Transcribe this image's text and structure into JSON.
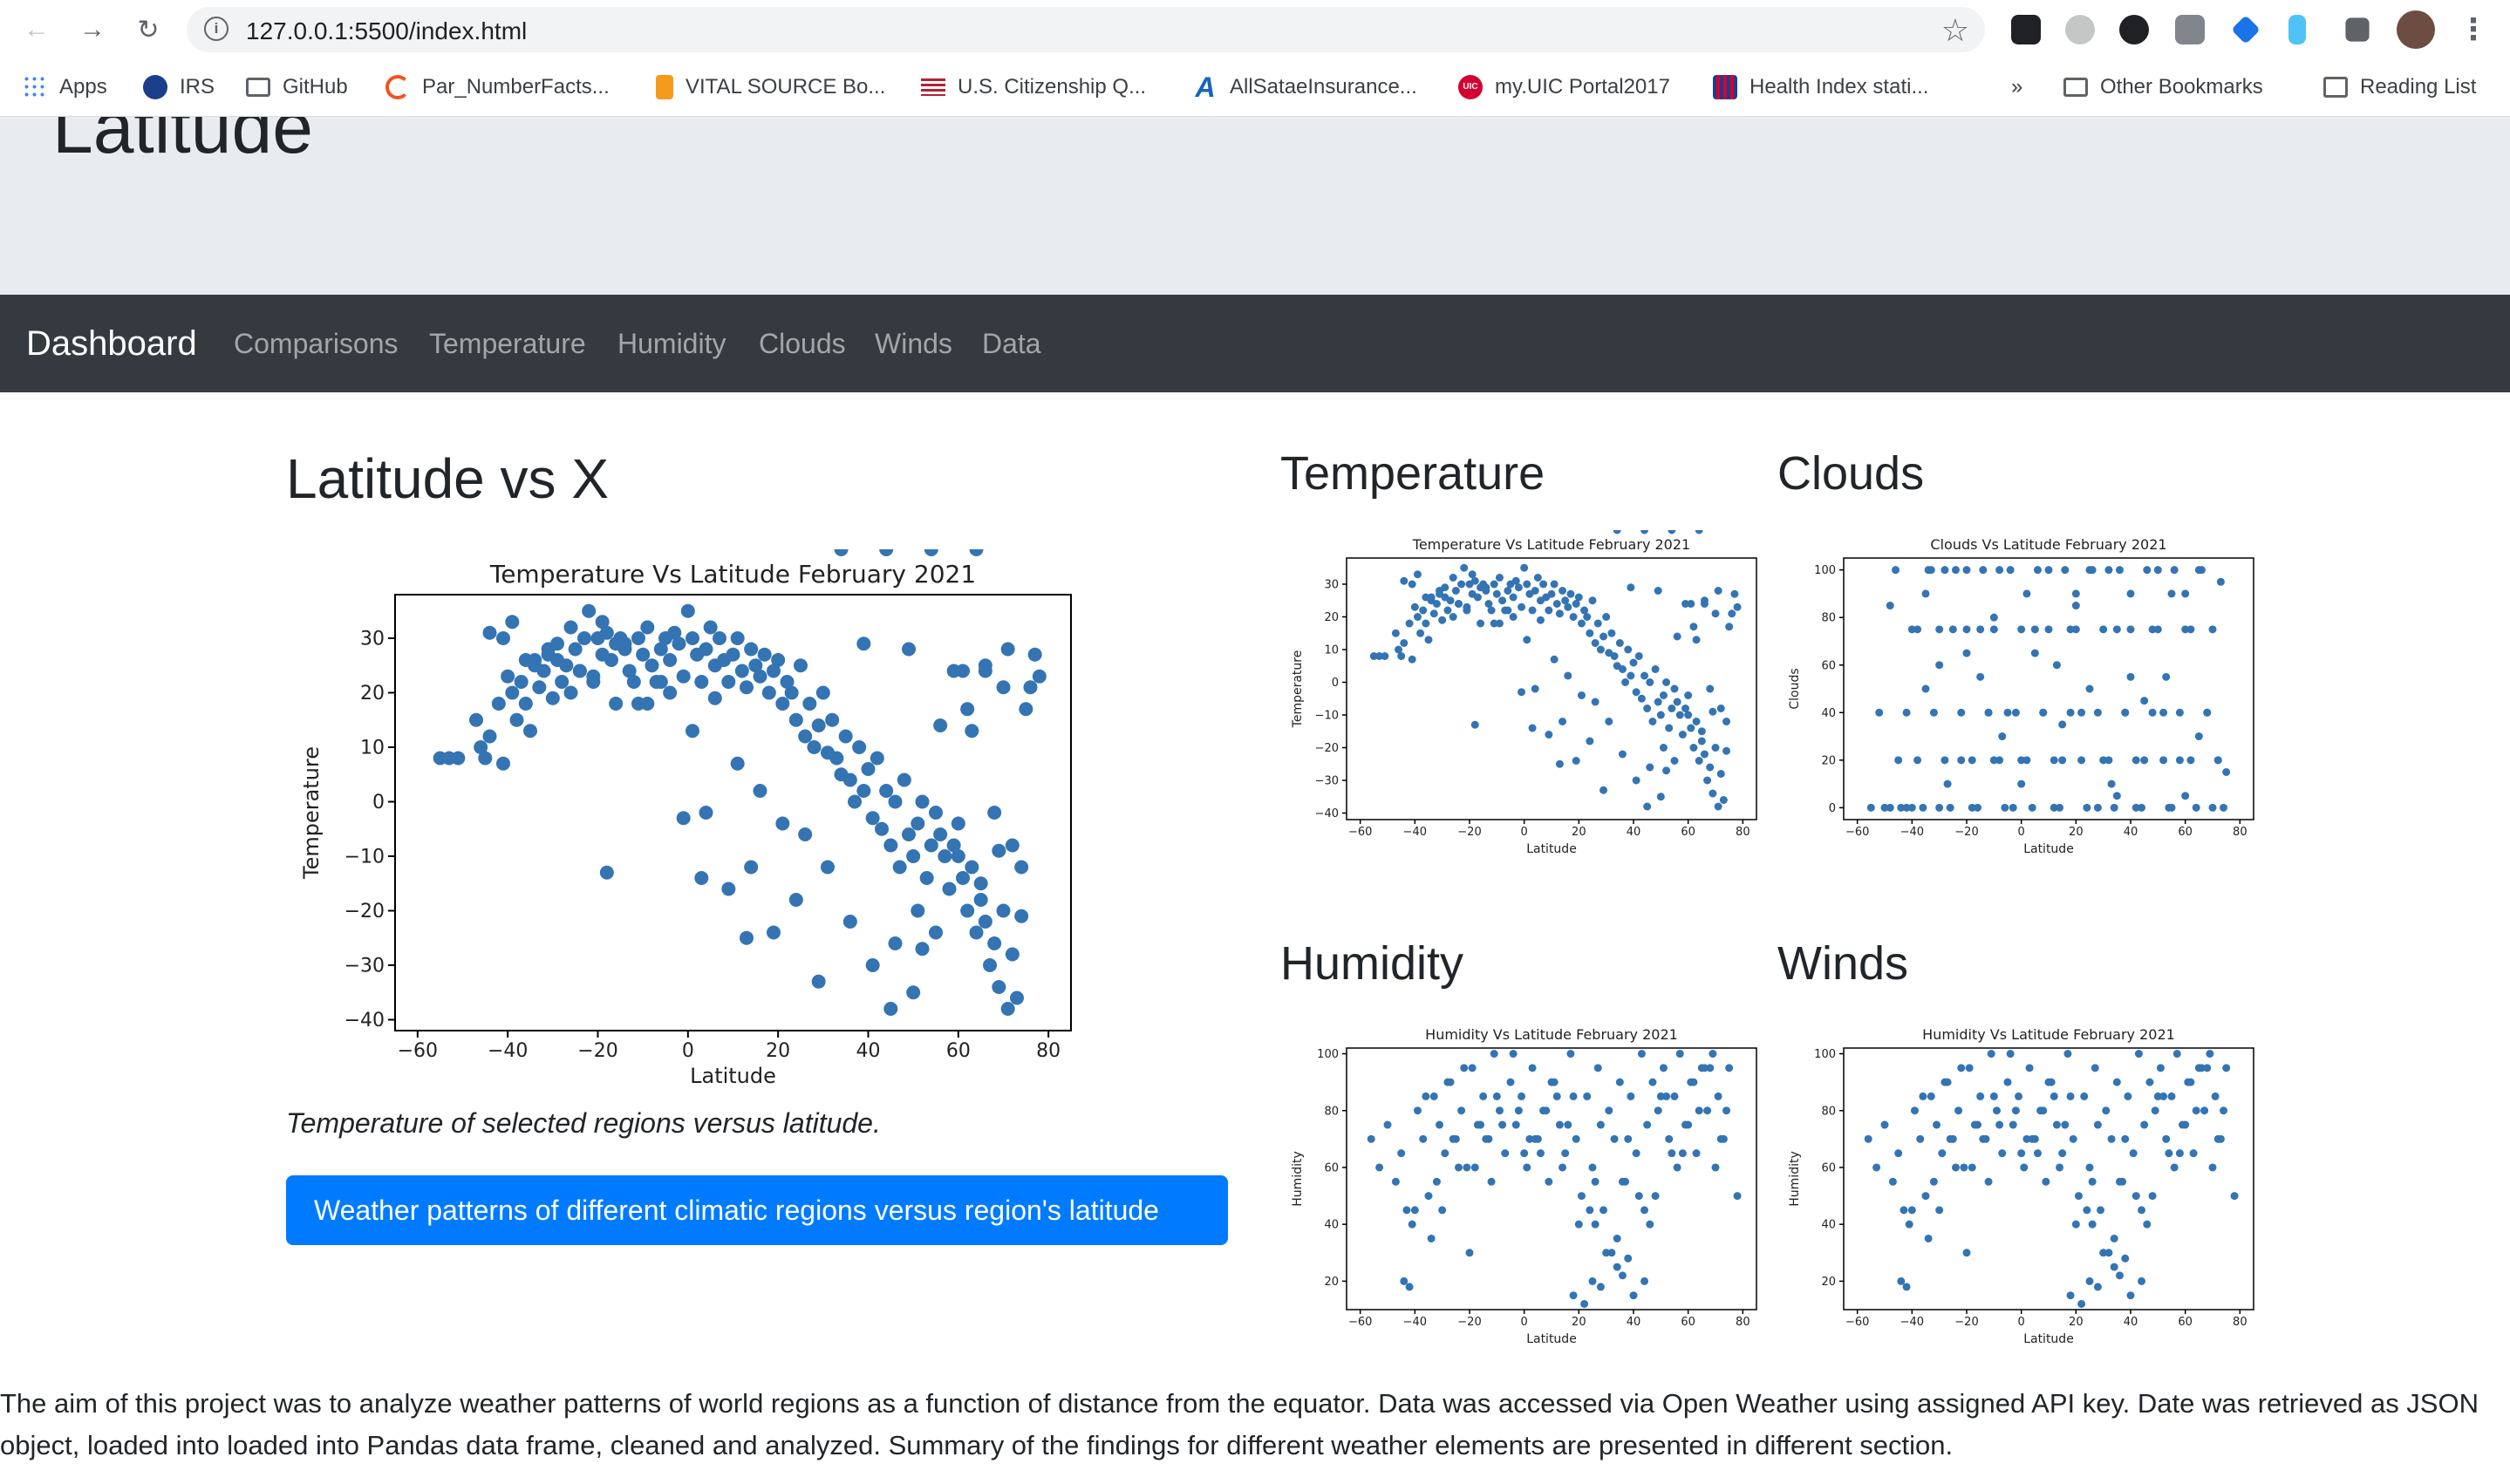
{
  "browser": {
    "url": "127.0.0.1:5500/index.html",
    "bookmarks": [
      {
        "label": "Apps",
        "icon": "apps-grid-icon",
        "color": "#4285f4"
      },
      {
        "label": "IRS",
        "icon": "irs-logo-icon",
        "color": "#1b3f8b"
      },
      {
        "label": "GitHub",
        "icon": "folder-icon",
        "color": "#5f6368"
      },
      {
        "label": "Par_NumberFacts...",
        "icon": "loading-ring-icon",
        "color": "#f4511e"
      },
      {
        "label": "VITAL SOURCE Bo...",
        "icon": "vitalsource-icon",
        "color": "#f59b1c"
      },
      {
        "label": "U.S. Citizenship Q...",
        "icon": "us-flag-icon",
        "color": "#b22234"
      },
      {
        "label": "AllSataeInsurance...",
        "icon": "allstate-icon",
        "color": "#1565c0"
      },
      {
        "label": "my.UIC Portal2017",
        "icon": "uic-logo-icon",
        "color": "#d50032"
      },
      {
        "label": "Health Index stati...",
        "icon": "health-index-icon",
        "color": "#1b3f8b"
      }
    ],
    "overflow": "»",
    "other_bookmarks": "Other Bookmarks",
    "reading_list": "Reading List"
  },
  "page": {
    "header": "Latitude",
    "nav": {
      "brand": "Dashboard",
      "links": [
        "Comparisons",
        "Temperature",
        "Humidity",
        "Clouds",
        "Winds",
        "Data"
      ]
    },
    "main": {
      "title": "Latitude vs X",
      "caption": "Temperature of selected regions versus latitude.",
      "button": "Weather patterns of different climatic regions versus region's latitude"
    },
    "thumbs": {
      "temperature": "Temperature",
      "clouds": "Clouds",
      "humidity": "Humidity",
      "winds": "Winds"
    },
    "summary": "The aim of this project was to analyze weather patterns of world regions as a function of distance from the equator. Data was accessed via Open Weather using assigned API key. Date was retrieved as JSON object, loaded into loaded into Pandas data frame, cleaned and analyzed. Summary of the findings for different weather elements are presented in different section."
  },
  "colors": {
    "marker": "#3474b3",
    "navbar": "#343a40",
    "jumbotron": "#e9ecef",
    "button": "#007bff"
  },
  "chart_data": [
    {
      "id": "main-temperature",
      "type": "scatter",
      "title": "Temperature Vs Latitude February 2021",
      "xlabel": "Latitude",
      "ylabel": "Temperature",
      "xlim": [
        -65,
        85
      ],
      "ylim": [
        -42,
        38
      ],
      "xticks": [
        -60,
        -40,
        -20,
        0,
        20,
        40,
        60,
        80
      ],
      "yticks": [
        -40,
        -30,
        -20,
        -10,
        0,
        10,
        20,
        30
      ],
      "x": [
        -55,
        -53,
        -51,
        -47,
        -46,
        -45,
        -44,
        -42,
        -41,
        -40,
        -39,
        -38,
        -37,
        -36,
        -35,
        -34,
        -33,
        -32,
        -31,
        -30,
        -29,
        -28,
        -27,
        -26,
        -25,
        -24,
        -23,
        -22,
        -21,
        -20,
        -19,
        -18,
        -17,
        -16,
        -15,
        -14,
        -13,
        -12,
        -11,
        -10,
        -9,
        -8,
        -7,
        -6,
        -5,
        -4,
        -3,
        -2,
        -1,
        0,
        1,
        2,
        3,
        4,
        5,
        6,
        7,
        8,
        9,
        10,
        11,
        12,
        13,
        14,
        15,
        16,
        17,
        18,
        19,
        20,
        21,
        22,
        23,
        24,
        25,
        26,
        27,
        28,
        29,
        30,
        31,
        32,
        33,
        34,
        35,
        36,
        37,
        38,
        39,
        40,
        41,
        42,
        43,
        44,
        45,
        46,
        47,
        48,
        49,
        50,
        51,
        52,
        53,
        54,
        55,
        56,
        57,
        58,
        59,
        60,
        61,
        62,
        63,
        64,
        65,
        66,
        67,
        68,
        69,
        70,
        71,
        72,
        73,
        74,
        75,
        76,
        77,
        78,
        -44,
        -39,
        -34,
        -29,
        -24,
        -19,
        -14,
        -9,
        -4,
        1,
        6,
        11,
        16,
        21,
        26,
        31,
        36,
        41,
        46,
        51,
        56,
        61,
        66,
        71,
        -41,
        -31,
        -21,
        -11,
        -1,
        9,
        19,
        29,
        39,
        49,
        59,
        69,
        -18,
        3,
        13,
        50,
        55,
        65,
        68,
        72,
        74,
        45,
        52,
        60,
        63,
        70,
        62,
        66,
        -36,
        -26,
        -16,
        -6,
        4,
        14,
        24,
        34,
        44,
        54,
        64
      ],
      "y": [
        8,
        8,
        8,
        15,
        10,
        8,
        12,
        18,
        7,
        23,
        20,
        15,
        22,
        18,
        13,
        25,
        21,
        24,
        27,
        19,
        26,
        22,
        25,
        20,
        28,
        24,
        30,
        35,
        22,
        30,
        27,
        31,
        26,
        18,
        30,
        28,
        24,
        22,
        30,
        27,
        32,
        25,
        22,
        28,
        30,
        26,
        31,
        29,
        23,
        35,
        30,
        27,
        22,
        28,
        32,
        25,
        30,
        26,
        22,
        27,
        30,
        24,
        21,
        28,
        25,
        23,
        27,
        20,
        24,
        26,
        18,
        22,
        20,
        15,
        25,
        12,
        18,
        10,
        14,
        20,
        9,
        15,
        8,
        5,
        12,
        4,
        0,
        10,
        2,
        6,
        -3,
        8,
        -5,
        2,
        -8,
        0,
        -12,
        4,
        -6,
        -10,
        -4,
        0,
        -14,
        -8,
        -2,
        -6,
        -10,
        -16,
        -8,
        -4,
        -14,
        -20,
        -12,
        -24,
        -18,
        -22,
        -30,
        -26,
        -34,
        -20,
        -38,
        -28,
        -36,
        -21,
        17,
        21,
        27,
        23,
        31,
        33,
        26,
        29,
        24,
        33,
        29,
        18,
        20,
        13,
        19,
        7,
        2,
        -4,
        -6,
        -12,
        -22,
        -30,
        -26,
        -20,
        14,
        24,
        25,
        28,
        30,
        28,
        23,
        18,
        -3,
        -16,
        -24,
        -33,
        29,
        28,
        24,
        -9,
        -13,
        -14,
        -25,
        -35,
        -24,
        -15,
        -2,
        -8,
        -12,
        -38,
        -27,
        -10,
        13,
        21,
        17,
        24,
        26,
        32,
        29,
        22,
        -2,
        -12,
        -18
      ]
    },
    {
      "id": "thumb-temperature",
      "type": "scatter",
      "title": "Temperature Vs Latitude February 2021",
      "xlabel": "Latitude",
      "ylabel": "Temperature",
      "xlim": [
        -65,
        85
      ],
      "ylim": [
        -42,
        38
      ],
      "xticks": [
        -60,
        -40,
        -20,
        0,
        20,
        40,
        60,
        80
      ],
      "yticks": [
        -40,
        -30,
        -20,
        -10,
        0,
        10,
        20,
        30
      ],
      "same_as": "main-temperature"
    },
    {
      "id": "thumb-clouds",
      "type": "scatter",
      "title": "Clouds Vs Latitude February 2021",
      "xlabel": "Latitude",
      "ylabel": "Clouds",
      "xlim": [
        -65,
        85
      ],
      "ylim": [
        -5,
        105
      ],
      "xticks": [
        -60,
        -40,
        -20,
        0,
        20,
        40,
        60,
        80
      ],
      "yticks": [
        0,
        20,
        40,
        60,
        80,
        100
      ],
      "x": [
        -55,
        -52,
        -48,
        -45,
        -42,
        -40,
        -38,
        -35,
        -33,
        -30,
        -28,
        -25,
        -22,
        -20,
        -18,
        -15,
        -12,
        -10,
        -8,
        -5,
        -3,
        0,
        2,
        5,
        8,
        10,
        12,
        15,
        18,
        20,
        22,
        25,
        28,
        30,
        32,
        35,
        38,
        40,
        42,
        45,
        48,
        50,
        52,
        55,
        58,
        60,
        62,
        65,
        68,
        70,
        72,
        -50,
        -44,
        -36,
        -26,
        -16,
        -6,
        4,
        14,
        24,
        34,
        44,
        54,
        64,
        74,
        -46,
        -34,
        -24,
        -14,
        -4,
        6,
        16,
        26,
        36,
        46,
        56,
        66,
        -40,
        -30,
        -20,
        -10,
        0,
        10,
        20,
        30,
        40,
        50,
        60,
        70,
        -38,
        -28,
        -18,
        -8,
        2,
        12,
        22,
        32,
        42,
        52,
        62,
        72,
        -42,
        -32,
        -22,
        -12,
        -2,
        8,
        18,
        28,
        38,
        48,
        58,
        68,
        -30,
        -15,
        5,
        25,
        45,
        65,
        -48,
        -27,
        -7,
        13,
        33,
        53,
        73,
        -20,
        0,
        20,
        40,
        60,
        -35,
        -10,
        15,
        35,
        55,
        75
      ],
      "y": [
        0,
        40,
        0,
        20,
        0,
        0,
        75,
        90,
        100,
        0,
        100,
        75,
        20,
        100,
        0,
        75,
        40,
        20,
        100,
        40,
        0,
        20,
        90,
        75,
        40,
        100,
        0,
        20,
        75,
        90,
        40,
        100,
        0,
        20,
        100,
        75,
        40,
        90,
        0,
        20,
        75,
        100,
        40,
        0,
        20,
        90,
        75,
        100,
        40,
        0,
        20,
        0,
        0,
        0,
        0,
        0,
        0,
        0,
        0,
        0,
        0,
        0,
        0,
        0,
        0,
        100,
        100,
        100,
        100,
        100,
        100,
        100,
        100,
        100,
        100,
        100,
        100,
        75,
        75,
        75,
        75,
        75,
        75,
        75,
        75,
        75,
        75,
        75,
        75,
        20,
        20,
        20,
        20,
        20,
        20,
        20,
        20,
        20,
        20,
        20,
        20,
        40,
        40,
        40,
        40,
        40,
        40,
        40,
        40,
        40,
        40,
        40,
        40,
        60,
        55,
        65,
        50,
        45,
        30,
        85,
        10,
        30,
        60,
        10,
        55,
        95,
        65,
        10,
        85,
        55,
        5,
        50,
        80,
        35,
        5,
        90,
        15
      ]
    },
    {
      "id": "thumb-humidity",
      "type": "scatter",
      "title": "Humidity Vs Latitude February 2021",
      "xlabel": "Latitude",
      "ylabel": "Humidity",
      "xlim": [
        -65,
        85
      ],
      "ylim": [
        10,
        102
      ],
      "xticks": [
        -60,
        -40,
        -20,
        0,
        20,
        40,
        60,
        80
      ],
      "yticks": [
        20,
        40,
        60,
        80,
        100
      ],
      "x": [
        -56,
        -53,
        -50,
        -47,
        -45,
        -43,
        -41,
        -39,
        -37,
        -35,
        -33,
        -31,
        -29,
        -27,
        -25,
        -23,
        -21,
        -19,
        -17,
        -15,
        -13,
        -11,
        -9,
        -7,
        -5,
        -3,
        -1,
        1,
        3,
        5,
        7,
        9,
        11,
        13,
        15,
        17,
        19,
        21,
        23,
        25,
        27,
        29,
        31,
        33,
        35,
        37,
        39,
        41,
        43,
        45,
        47,
        49,
        51,
        53,
        55,
        57,
        59,
        61,
        63,
        65,
        67,
        69,
        71,
        73,
        75,
        78,
        -40,
        -34,
        -28,
        -22,
        -16,
        -10,
        -4,
        2,
        8,
        14,
        20,
        26,
        32,
        38,
        44,
        50,
        56,
        62,
        68,
        74,
        -44,
        -36,
        -26,
        -18,
        -8,
        0,
        10,
        18,
        28,
        36,
        46,
        54,
        64,
        72,
        -32,
        -24,
        -14,
        -2,
        6,
        16,
        24,
        34,
        42,
        52,
        60,
        70,
        18,
        22,
        25,
        28,
        34,
        38,
        40,
        44,
        30,
        36,
        -42,
        -30,
        -20,
        -12,
        4,
        12,
        26,
        48,
        58,
        66
      ],
      "y": [
        70,
        60,
        75,
        55,
        65,
        45,
        40,
        80,
        70,
        50,
        85,
        75,
        65,
        90,
        70,
        80,
        60,
        95,
        75,
        85,
        70,
        100,
        80,
        65,
        90,
        75,
        85,
        60,
        95,
        70,
        80,
        55,
        90,
        75,
        65,
        100,
        70,
        50,
        85,
        60,
        95,
        45,
        80,
        70,
        90,
        55,
        85,
        65,
        100,
        75,
        90,
        80,
        95,
        70,
        85,
        100,
        75,
        90,
        65,
        95,
        80,
        100,
        85,
        70,
        95,
        50,
        45,
        35,
        90,
        95,
        75,
        85,
        100,
        70,
        80,
        60,
        40,
        55,
        30,
        70,
        45,
        85,
        60,
        90,
        95,
        80,
        20,
        85,
        70,
        60,
        75,
        65,
        90,
        85,
        75,
        55,
        40,
        65,
        80,
        70,
        55,
        60,
        70,
        80,
        65,
        75,
        45,
        35,
        50,
        85,
        75,
        60,
        15,
        12,
        20,
        18,
        25,
        28,
        15,
        20,
        30,
        22,
        18,
        45,
        30,
        55,
        70,
        85,
        40,
        50,
        65,
        95
      ]
    },
    {
      "id": "thumb-winds",
      "type": "scatter",
      "title": "Humidity Vs Latitude February 2021",
      "xlabel": "Latitude",
      "ylabel": "Humidity",
      "xlim": [
        -65,
        85
      ],
      "ylim": [
        10,
        102
      ],
      "xticks": [
        -60,
        -40,
        -20,
        0,
        20,
        40,
        60,
        80
      ],
      "yticks": [
        20,
        40,
        60,
        80,
        100
      ],
      "same_as": "thumb-humidity"
    }
  ]
}
